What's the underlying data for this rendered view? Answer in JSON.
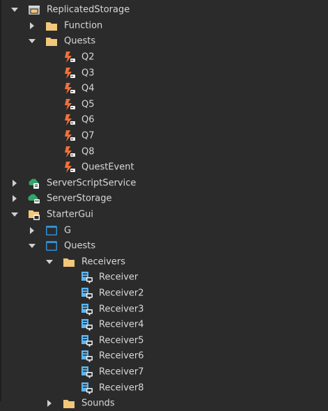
{
  "explorer": {
    "replicated_storage": {
      "label": "ReplicatedStorage",
      "icon": "replicated-storage-icon"
    },
    "function_folder": {
      "label": "Function",
      "icon": "folder-icon"
    },
    "quests_folder": {
      "label": "Quests",
      "icon": "folder-icon"
    },
    "quest_events": [
      {
        "label": "Q2"
      },
      {
        "label": "Q3"
      },
      {
        "label": "Q4"
      },
      {
        "label": "Q5"
      },
      {
        "label": "Q6"
      },
      {
        "label": "Q7"
      },
      {
        "label": "Q8"
      },
      {
        "label": "QuestEvent"
      }
    ],
    "server_script_service": {
      "label": "ServerScriptService",
      "icon": "server-script-service-icon"
    },
    "server_storage": {
      "label": "ServerStorage",
      "icon": "server-storage-icon"
    },
    "starter_gui": {
      "label": "StarterGui",
      "icon": "starter-gui-icon"
    },
    "g_gui": {
      "label": "G",
      "icon": "screen-gui-icon"
    },
    "quests_gui": {
      "label": "Quests",
      "icon": "screen-gui-icon"
    },
    "receivers_folder": {
      "label": "Receivers",
      "icon": "folder-icon"
    },
    "receivers": [
      {
        "label": "Receiver"
      },
      {
        "label": "Receiver2"
      },
      {
        "label": "Receiver3"
      },
      {
        "label": "Receiver4"
      },
      {
        "label": "Receiver5"
      },
      {
        "label": "Receiver6"
      },
      {
        "label": "Receiver7"
      },
      {
        "label": "Receiver8"
      }
    ],
    "sounds_folder": {
      "label": "Sounds",
      "icon": "folder-icon"
    }
  },
  "colors": {
    "background": "#2b2b2b",
    "text": "#d8d8d8",
    "folder": "#f2c77a",
    "remote_event": "#f0703a",
    "script_icon": "#5db7f2",
    "service_green": "#2fa56a"
  }
}
